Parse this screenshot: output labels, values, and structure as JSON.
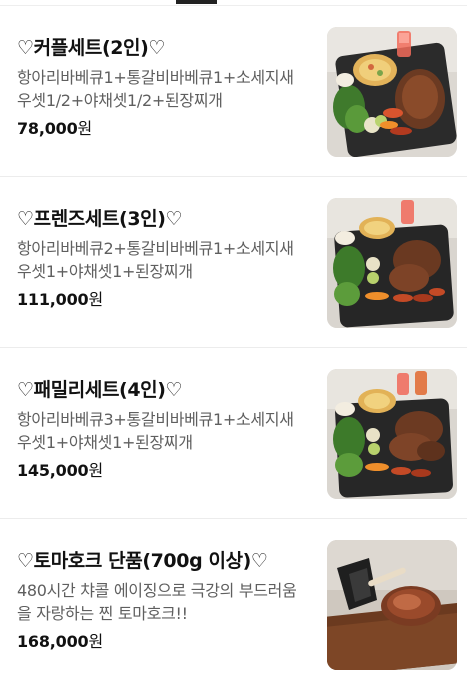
{
  "menu": {
    "items": [
      {
        "title": "♡커플세트(2인)♡",
        "description": "항아리바베큐1+통갈비바베큐1+소세지새우셋1/2+야채셋1/2+된장찌개",
        "price": "78,000",
        "currency": "원",
        "image": "couple-set-bbq-photo"
      },
      {
        "title": "♡프렌즈세트(3인)♡",
        "description": "항아리바베큐2+통갈비바베큐1+소세지새우셋1+야채셋1+된장찌개",
        "price": "111,000",
        "currency": "원",
        "image": "friends-set-bbq-photo"
      },
      {
        "title": "♡패밀리세트(4인)♡",
        "description": "항아리바베큐3+통갈비바베큐1+소세지새우셋1+야채셋1+된장찌개",
        "price": "145,000",
        "currency": "원",
        "image": "family-set-bbq-photo"
      },
      {
        "title": "♡토마호크 단품(700g 이상)♡",
        "description": "480시간 챠콜 에이징으로 극강의 부드러움을 자랑하는 찐 토마호크!!",
        "price": "168,000",
        "currency": "원",
        "image": "tomahawk-steak-photo"
      }
    ]
  },
  "colors": {
    "title": "#111111",
    "description": "#5f5f5f",
    "divider": "#ececec",
    "tab_indicator": "#222222"
  }
}
